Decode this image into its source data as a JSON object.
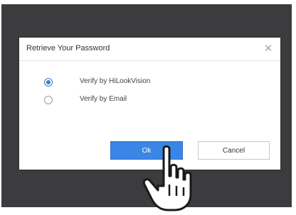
{
  "dialog": {
    "title": "Retrieve Your Password",
    "close_icon": "close-icon",
    "options": [
      {
        "label": "Verify by HiLookVision",
        "selected": true
      },
      {
        "label": "Verify by Email",
        "selected": false
      }
    ],
    "ok_label": "Ok",
    "cancel_label": "Cancel"
  },
  "cursor": {
    "icon": "hand-pointer-icon"
  },
  "colors": {
    "backdrop": "#3c3c3e",
    "accent": "#3a86e6",
    "radio_selected": "#3a7bd5"
  }
}
